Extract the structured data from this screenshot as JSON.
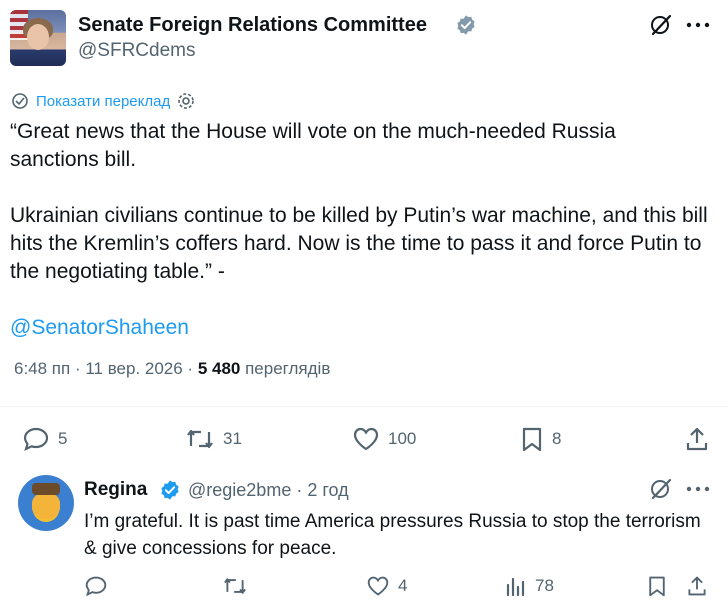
{
  "tweet": {
    "author_name": "Senate Foreign Relations Committee",
    "author_handle": "@SFRCdems",
    "translate_label": "Показати переклад",
    "text": "“Great news that the House will vote on the much-needed Russia sanctions bill.\n\nUkrainian civilians continue to be killed by Putin’s war machine, and this bill hits the Kremlin’s coffers hard. Now is the time to pass it and force Putin to the negotiating table.” -",
    "mention": "@SenatorShaheen",
    "time": "6:48 пп · 11 вер. 2026 · ",
    "views_count": "5 480",
    "views_label": " переглядів",
    "actions": {
      "replies": "5",
      "reposts": "31",
      "likes": "100",
      "bookmarks": "8"
    }
  },
  "reply": {
    "author_name": "Regina",
    "author_handle": "@regie2bme · 2 год",
    "text": "I’m grateful. It is past time America pressures Russia to stop the terrorism & give concessions for peace.",
    "actions": {
      "likes": "4",
      "views": "78"
    }
  },
  "colors": {
    "accent": "#1d9bf0",
    "text": "#0f1419",
    "muted": "#536471",
    "verified_gray": "#829aab"
  },
  "icons": [
    "verified-badge-icon",
    "grok-icon",
    "more-icon",
    "translate-icon",
    "settings-icon",
    "reply-icon",
    "repost-icon",
    "like-icon",
    "bookmark-icon",
    "share-icon",
    "views-icon"
  ]
}
